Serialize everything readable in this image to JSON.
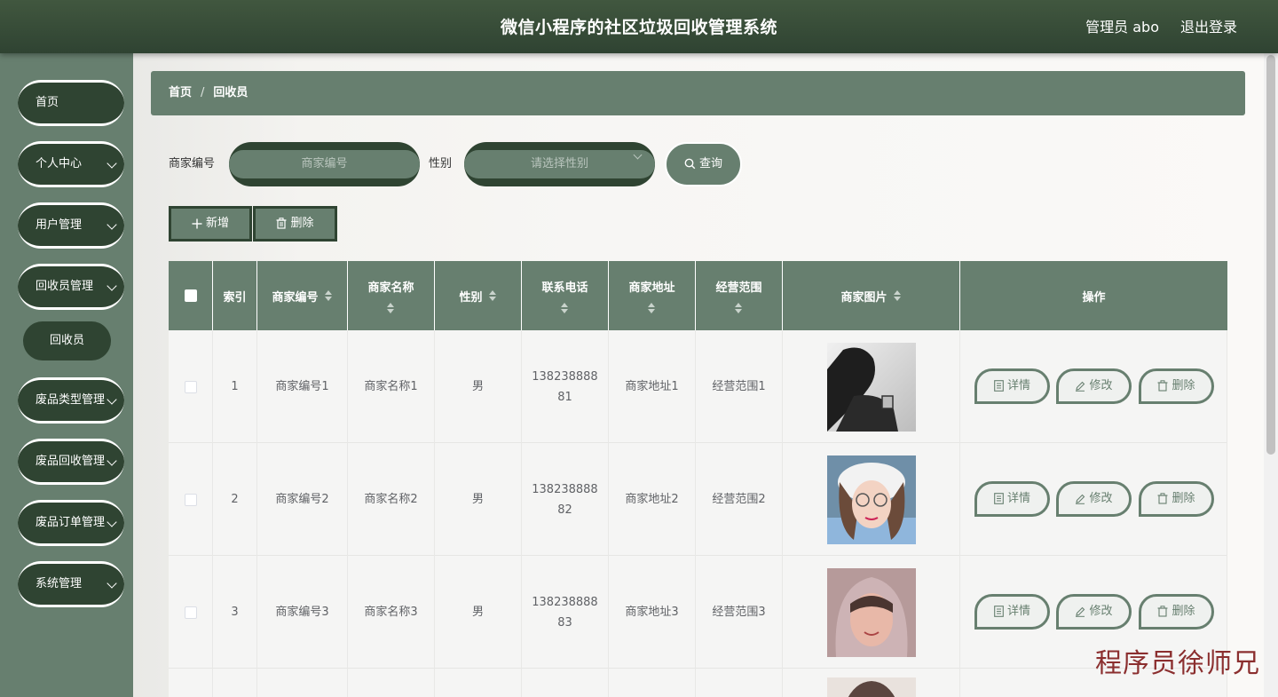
{
  "header": {
    "title": "微信小程序的社区垃圾回收管理系统",
    "user": "管理员 abo",
    "logout": "退出登录"
  },
  "sidebar": {
    "items": [
      {
        "label": "首页",
        "has_children": false
      },
      {
        "label": "个人中心",
        "has_children": true
      },
      {
        "label": "用户管理",
        "has_children": true
      },
      {
        "label": "回收员管理",
        "has_children": true
      },
      {
        "label": "废品类型管理",
        "has_children": true
      },
      {
        "label": "废品回收管理",
        "has_children": true
      },
      {
        "label": "废品订单管理",
        "has_children": true
      },
      {
        "label": "系统管理",
        "has_children": true
      }
    ],
    "subitem": "回收员"
  },
  "breadcrumb": {
    "home": "首页",
    "sep": "/",
    "current": "回收员"
  },
  "search": {
    "merchant_label": "商家编号",
    "merchant_placeholder": "商家编号",
    "gender_label": "性别",
    "gender_placeholder": "请选择性别",
    "query_label": "查询"
  },
  "actions": {
    "add": "新增",
    "delete": "删除"
  },
  "table": {
    "columns": [
      "索引",
      "商家编号",
      "商家名称",
      "性别",
      "联系电话",
      "商家地址",
      "经营范围",
      "商家图片",
      "操作"
    ],
    "rows": [
      {
        "index": "1",
        "code": "商家编号1",
        "name": "商家名称1",
        "gender": "男",
        "phone_a": "138238888",
        "phone_b": "81",
        "address": "商家地址1",
        "scope": "经营范围1",
        "photo": "man-silhouette"
      },
      {
        "index": "2",
        "code": "商家编号2",
        "name": "商家名称2",
        "gender": "男",
        "phone_a": "138238888",
        "phone_b": "82",
        "address": "商家地址2",
        "scope": "经营范围2",
        "photo": "girl-with-cap"
      },
      {
        "index": "3",
        "code": "商家编号3",
        "name": "商家名称3",
        "gender": "男",
        "phone_a": "138238888",
        "phone_b": "83",
        "address": "商家地址3",
        "scope": "经营范围3",
        "photo": "girl-with-hood"
      }
    ],
    "row_actions": {
      "detail": "详情",
      "edit": "修改",
      "delete": "删除"
    }
  },
  "watermark": "程序员徐师兄",
  "colors": {
    "primary": "#677f6f",
    "dark": "#2f4432",
    "header": "#3a4f3b"
  }
}
